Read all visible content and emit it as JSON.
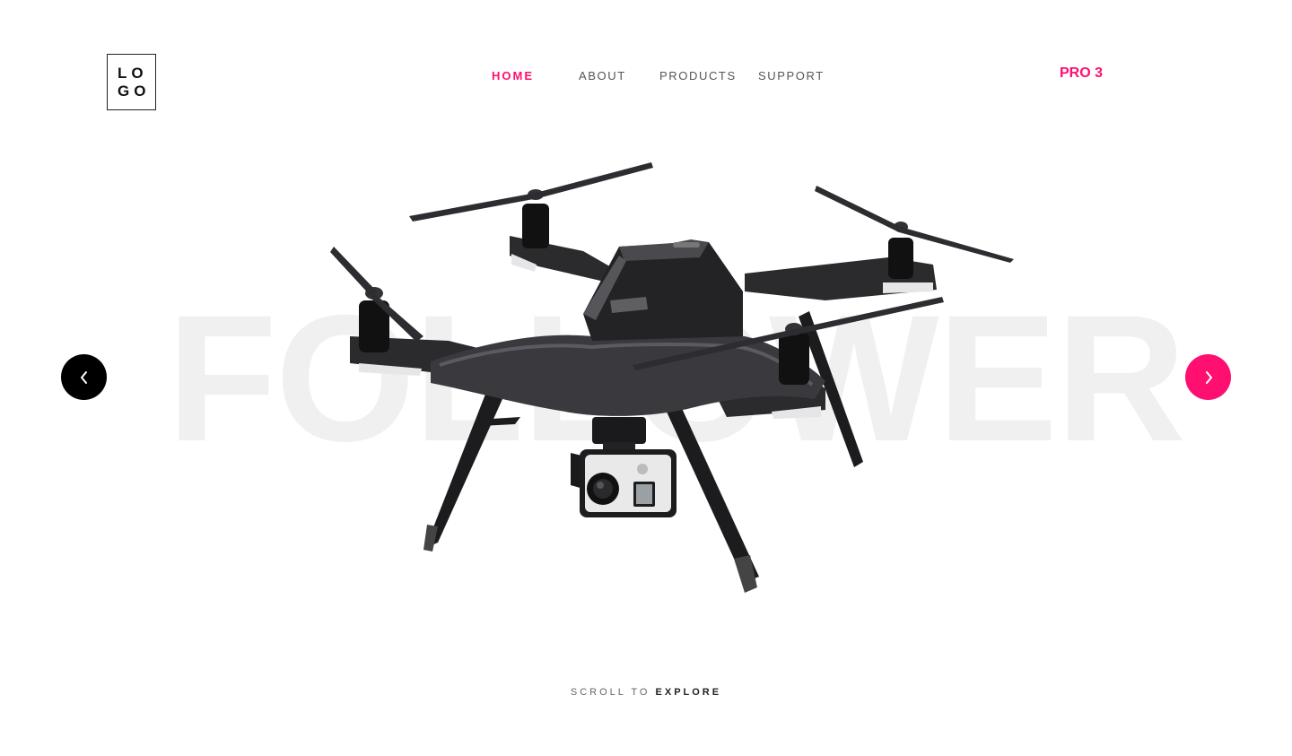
{
  "colors": {
    "accent": "#ff0f6f",
    "dark": "#000000",
    "nav_text": "#555555",
    "watermark": "#f0f0f0"
  },
  "logo": {
    "line1": "LO",
    "line2": "GO"
  },
  "nav": {
    "items": [
      {
        "label": "HOME",
        "active": true
      },
      {
        "label": "ABOUT",
        "active": false
      },
      {
        "label": "PRODUCTS",
        "active": false
      },
      {
        "label": "SUPPORT",
        "active": false
      }
    ]
  },
  "product_badge": "PRO 3",
  "hero": {
    "background_word": "FOLLOWER",
    "image": "quadcopter-drone-with-action-camera"
  },
  "slider": {
    "prev_icon": "chevron-left-icon",
    "next_icon": "chevron-right-icon"
  },
  "scroll_hint": {
    "prefix": "SCROLL TO",
    "emphasis": "EXPLORE"
  }
}
